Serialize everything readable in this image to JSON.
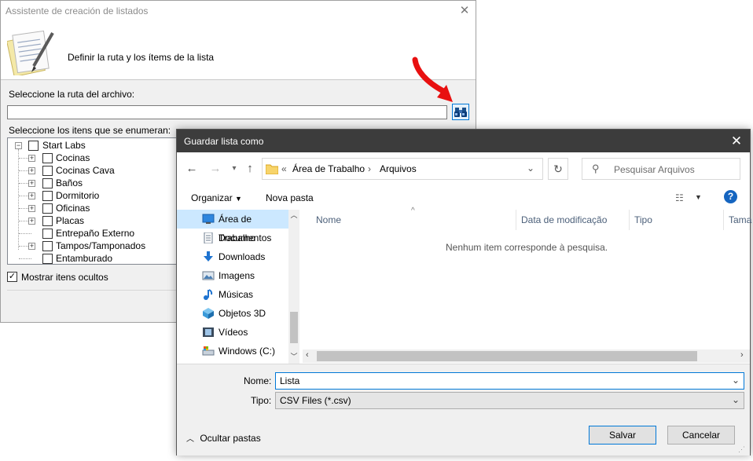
{
  "wizard": {
    "title": "Assistente de creación de listados",
    "heading": "Definir la ruta y los ítems de la lista",
    "path_label": "Seleccione la ruta del archivo:",
    "path_value": "",
    "items_label": "Seleccione los itens que se enumeran:",
    "tree": {
      "root": "Start Labs",
      "children": [
        "Cocinas",
        "Cocinas Cava",
        "Baños",
        "Dormitorio",
        "Oficinas",
        "Placas",
        "Entrepaño Externo",
        "Tampos/Tamponados",
        "Entamburado"
      ]
    },
    "show_hidden_label": "Mostrar itens ocultos",
    "show_hidden_checked": true,
    "close_glyph": "✕"
  },
  "save_dialog": {
    "title": "Guardar lista como",
    "close_glyph": "✕",
    "breadcrumb_prefix": "«",
    "breadcrumb": [
      "Área de Trabalho",
      "Arquivos"
    ],
    "search_placeholder": "Pesquisar Arquivos",
    "toolbar": {
      "organize": "Organizar",
      "new_folder": "Nova pasta"
    },
    "nav_items": [
      {
        "label": "Área de Trabalho",
        "icon": "desktop-icon"
      },
      {
        "label": "Documentos",
        "icon": "documents-icon"
      },
      {
        "label": "Downloads",
        "icon": "downloads-icon"
      },
      {
        "label": "Imagens",
        "icon": "pictures-icon"
      },
      {
        "label": "Músicas",
        "icon": "music-icon"
      },
      {
        "label": "Objetos 3D",
        "icon": "objects3d-icon"
      },
      {
        "label": "Vídeos",
        "icon": "videos-icon"
      },
      {
        "label": "Windows (C:)",
        "icon": "drive-icon"
      }
    ],
    "columns": [
      "Nome",
      "Data de modificação",
      "Tipo",
      "Tama"
    ],
    "empty_message": "Nenhum item corresponde à pesquisa.",
    "name_label": "Nome:",
    "name_value": "Lista",
    "type_label": "Tipo:",
    "type_value": "CSV Files (*.csv)",
    "hide_folders": "Ocultar pastas",
    "save_button": "Salvar",
    "cancel_button": "Cancelar"
  },
  "colors": {
    "accent": "#0078d7",
    "arrow": "#e81010",
    "titlebar_dark": "#3c3c3c"
  }
}
